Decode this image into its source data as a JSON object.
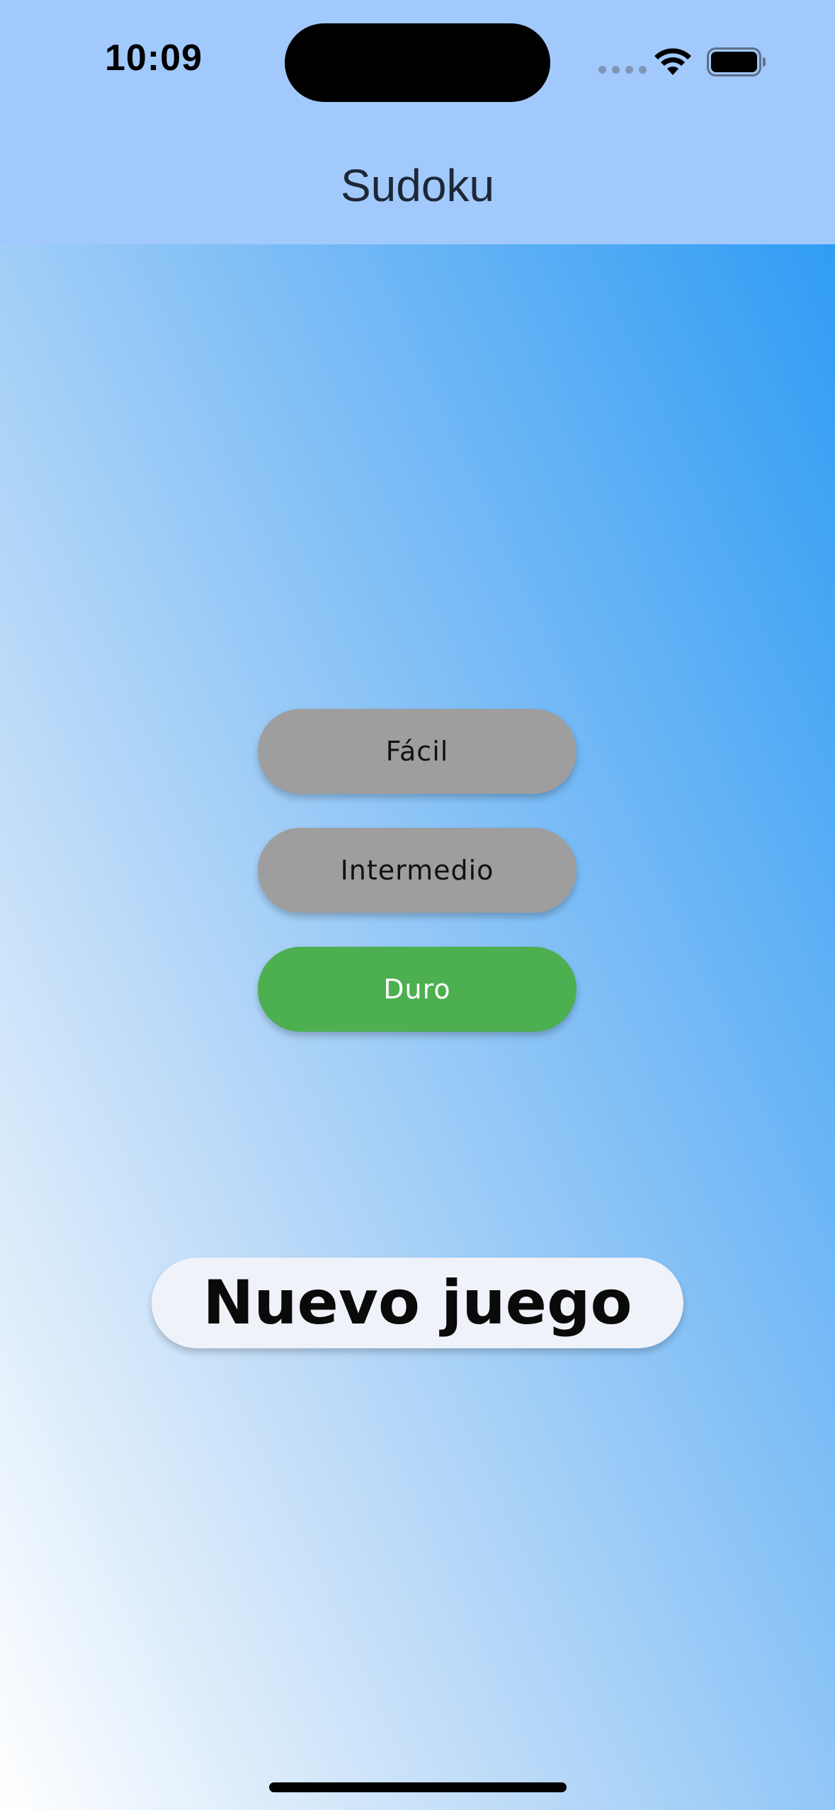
{
  "status_bar": {
    "time": "10:09",
    "icons": [
      "cellular-signal-icon",
      "wifi-icon",
      "battery-icon"
    ]
  },
  "app_bar": {
    "title": "Sudoku"
  },
  "difficulty": {
    "options": [
      "Fácil",
      "Intermedio",
      "Duro"
    ],
    "selected": "Duro"
  },
  "actions": {
    "new_game_label": "Nuevo juego"
  },
  "colors": {
    "header": "#a1c9fc",
    "gradient_top": "#2196f3",
    "gradient_bottom": "#ffffff",
    "unselected_button": "#9e9e9e",
    "selected_button": "#4caf50",
    "new_game_button": "#f0f2fa"
  }
}
